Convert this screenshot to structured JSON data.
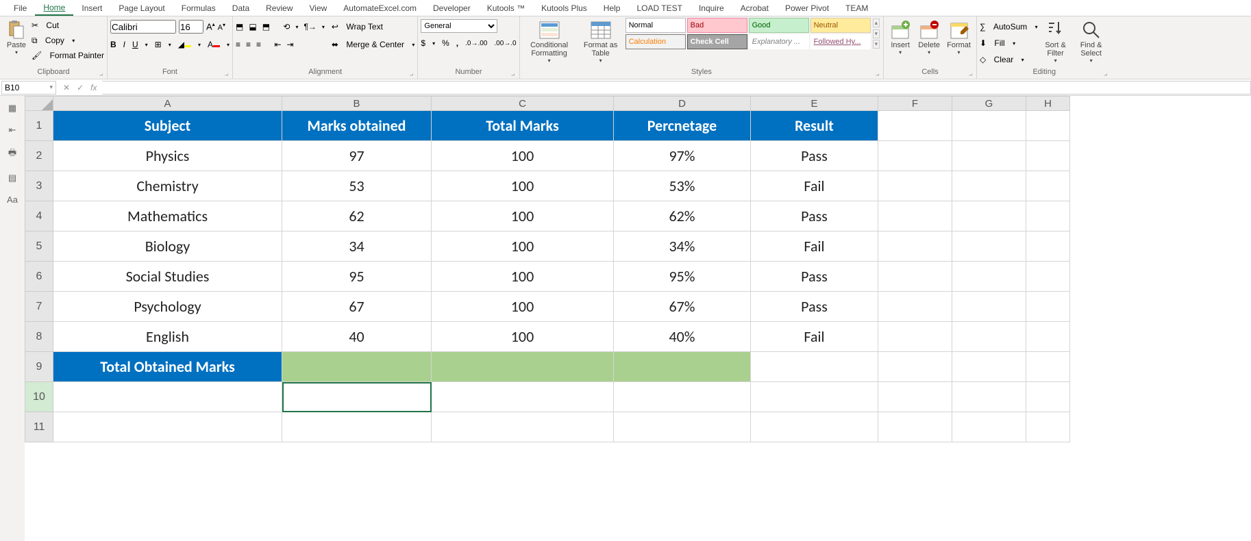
{
  "ribbonTabs": [
    "File",
    "Home",
    "Insert",
    "Page Layout",
    "Formulas",
    "Data",
    "Review",
    "View",
    "AutomateExcel.com",
    "Developer",
    "Kutools ™",
    "Kutools Plus",
    "Help",
    "LOAD TEST",
    "Inquire",
    "Acrobat",
    "Power Pivot",
    "TEAM"
  ],
  "activeTab": "Home",
  "clipboard": {
    "paste": "Paste",
    "cut": "Cut",
    "copy": "Copy",
    "formatPainter": "Format Painter",
    "group": "Clipboard"
  },
  "font": {
    "name": "Calibri",
    "size": "16",
    "group": "Font"
  },
  "alignment": {
    "wrap": "Wrap Text",
    "merge": "Merge & Center",
    "group": "Alignment"
  },
  "number": {
    "format": "General",
    "group": "Number"
  },
  "styles": {
    "condFmt": "Conditional Formatting",
    "fmtTable": "Format as Table",
    "items": [
      "Normal",
      "Bad",
      "Good",
      "Neutral",
      "Calculation",
      "Check Cell",
      "Explanatory ...",
      "Followed Hy..."
    ],
    "group": "Styles"
  },
  "cellsGroup": {
    "insert": "Insert",
    "delete": "Delete",
    "format": "Format",
    "group": "Cells"
  },
  "editing": {
    "autosum": "AutoSum",
    "fill": "Fill",
    "clear": "Clear",
    "sort": "Sort & Filter",
    "find": "Find & Select",
    "group": "Editing"
  },
  "nameBox": "B10",
  "formula": "",
  "colWidths": {
    "A": 334,
    "B": 218,
    "C": 266,
    "D": 200,
    "E": 186,
    "F": 108,
    "G": 108,
    "H": 64
  },
  "columns": [
    "A",
    "B",
    "C",
    "D",
    "E",
    "F",
    "G",
    "H"
  ],
  "headerRow": [
    "Subject",
    "Marks obtained",
    "Total Marks",
    "Percnetage",
    "Result"
  ],
  "dataRows": [
    [
      "Physics",
      "97",
      "100",
      "97%",
      "Pass"
    ],
    [
      "Chemistry",
      "53",
      "100",
      "53%",
      "Fail"
    ],
    [
      "Mathematics",
      "62",
      "100",
      "62%",
      "Pass"
    ],
    [
      "Biology",
      "34",
      "100",
      "34%",
      "Fail"
    ],
    [
      "Social Studies",
      "95",
      "100",
      "95%",
      "Pass"
    ],
    [
      "Psychology",
      "67",
      "100",
      "67%",
      "Pass"
    ],
    [
      "English",
      "40",
      "100",
      "40%",
      "Fail"
    ]
  ],
  "totalLabel": "Total Obtained Marks",
  "rowNumbers": [
    1,
    2,
    3,
    4,
    5,
    6,
    7,
    8,
    9,
    10,
    11
  ],
  "activeCell": "B10"
}
